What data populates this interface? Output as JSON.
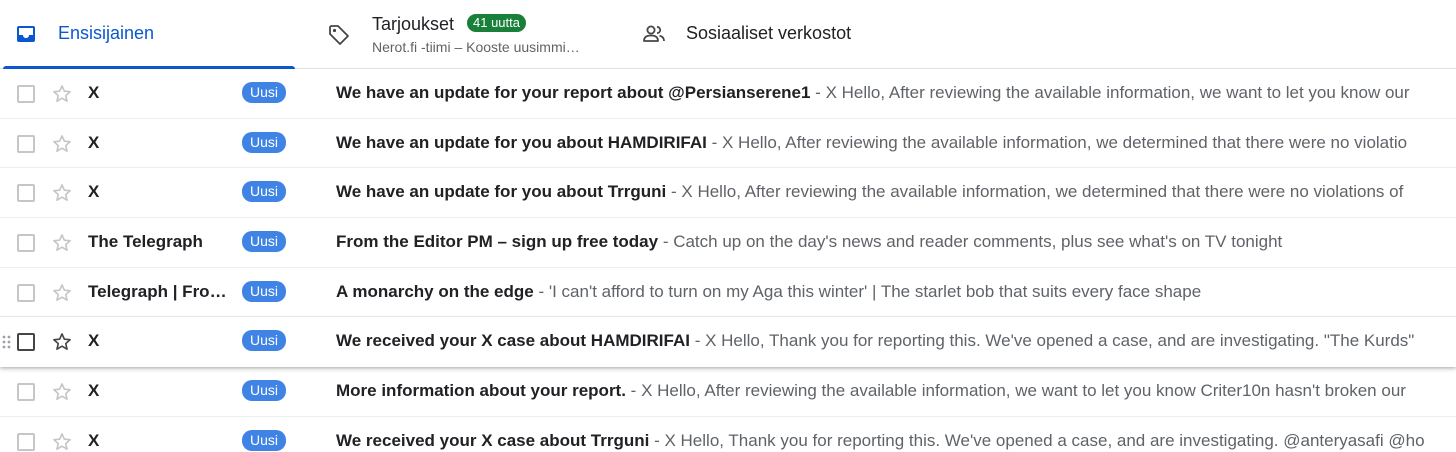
{
  "tabs": {
    "primary": {
      "label": "Ensisijainen",
      "icon": "inbox-icon"
    },
    "promotions": {
      "label": "Tarjoukset",
      "badge": "41 uutta",
      "subtitle": "Nerot.fi -tiimi – Kooste uusimmi…",
      "icon": "tag-icon"
    },
    "social": {
      "label": "Sosiaaliset verkostot",
      "icon": "people-icon"
    }
  },
  "colors": {
    "accent": "#0b57d0",
    "badge_green": "#188038",
    "label_blue": "#3f84e5"
  },
  "separator": " - ",
  "rows": [
    {
      "sender": "X",
      "label": "Uusi",
      "subject": "We have an update for your report about @Persianserene1",
      "snippet": "X Hello, After reviewing the available information, we want to let you know our"
    },
    {
      "sender": "X",
      "label": "Uusi",
      "subject": "We have an update for you about HAMDIRIFAI",
      "snippet": "X Hello, After reviewing the available information, we determined that there were no violatio"
    },
    {
      "sender": "X",
      "label": "Uusi",
      "subject": "We have an update for you about Trrguni",
      "snippet": "X Hello, After reviewing the available information, we determined that there were no violations of"
    },
    {
      "sender": "The Telegraph",
      "label": "Uusi",
      "subject": "From the Editor PM – sign up free today",
      "snippet": "Catch up on the day's news and reader comments, plus see what's on TV tonight"
    },
    {
      "sender": "Telegraph | Fro…",
      "label": "Uusi",
      "subject": "A monarchy on the edge",
      "snippet": "'I can't afford to turn on my Aga this winter' | The starlet bob that suits every face shape"
    },
    {
      "sender": "X",
      "label": "Uusi",
      "subject": "We received your X case about HAMDIRIFAI",
      "snippet": "X Hello, Thank you for reporting this. We've opened a case, and are investigating. \"The Kurds\""
    },
    {
      "sender": "X",
      "label": "Uusi",
      "subject": "More information about your report.",
      "snippet": "X Hello, After reviewing the available information, we want to let you know Criter10n hasn't broken our"
    },
    {
      "sender": "X",
      "label": "Uusi",
      "subject": "We received your X case about Trrguni",
      "snippet": "X Hello, Thank you for reporting this. We've opened a case, and are investigating. @anteryasafi @ho"
    }
  ]
}
